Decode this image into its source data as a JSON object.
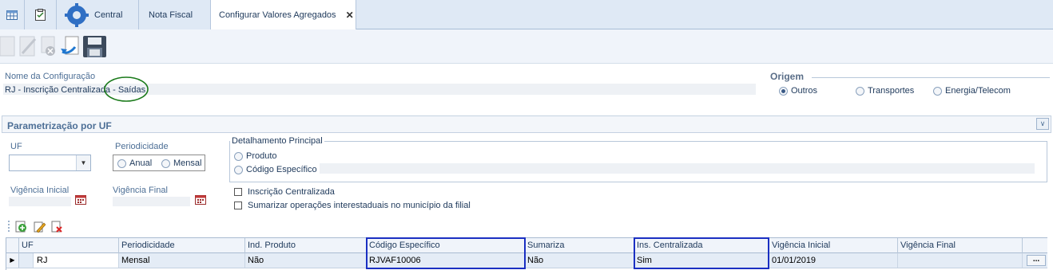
{
  "tabs": [
    {
      "label": "",
      "icon": "grid-icon"
    },
    {
      "label": "",
      "icon": "clipboard-icon"
    },
    {
      "label": "Central",
      "icon": "gear-icon"
    },
    {
      "label": "Nota Fiscal"
    },
    {
      "label": "Configurar Valores Agregados",
      "active": true,
      "close": "✕"
    }
  ],
  "toolbar": {
    "icons": [
      "new-icon",
      "edit-icon",
      "cancel-icon",
      "undo-icon",
      "save-icon"
    ]
  },
  "header": {
    "name_label": "Nome da Configuração",
    "name_value": "RJ - Inscrição Centralizada - Saídas",
    "origem_label": "Origem",
    "origem_options": [
      "Outros",
      "Transportes",
      "Energia/Telecom"
    ],
    "origem_selected": "Outros"
  },
  "group": {
    "title": "Parametrização por UF",
    "uf_label": "UF",
    "uf_value": "",
    "periodicidade_label": "Periodicidade",
    "periodicidade_options": [
      "Anual",
      "Mensal"
    ],
    "detalhamento_label": "Detalhamento Principal",
    "detalhamento_options": [
      "Produto",
      "Código Específico"
    ],
    "vigencia_inicial_label": "Vigência Inicial",
    "vigencia_final_label": "Vigência Final",
    "check_inscricao": "Inscrição Centralizada",
    "check_sumarizar": "Sumarizar operações interestaduais no município da filial"
  },
  "grid": {
    "columns": [
      "UF",
      "Periodicidade",
      "Ind. Produto",
      "Código Específico",
      "Sumariza",
      "Ins. Centralizada",
      "Vigência Inicial",
      "Vigência Final"
    ],
    "rows": [
      [
        "RJ",
        "Mensal",
        "Não",
        "RJVAF10006",
        "Não",
        "Sim",
        "01/01/2019",
        ""
      ]
    ],
    "row_indicator": "▶",
    "ellipsis": "..."
  },
  "colors": {
    "accent": "#1e395b",
    "highlight_blue": "#1a2fc2",
    "highlight_green": "#1a7a1a"
  }
}
